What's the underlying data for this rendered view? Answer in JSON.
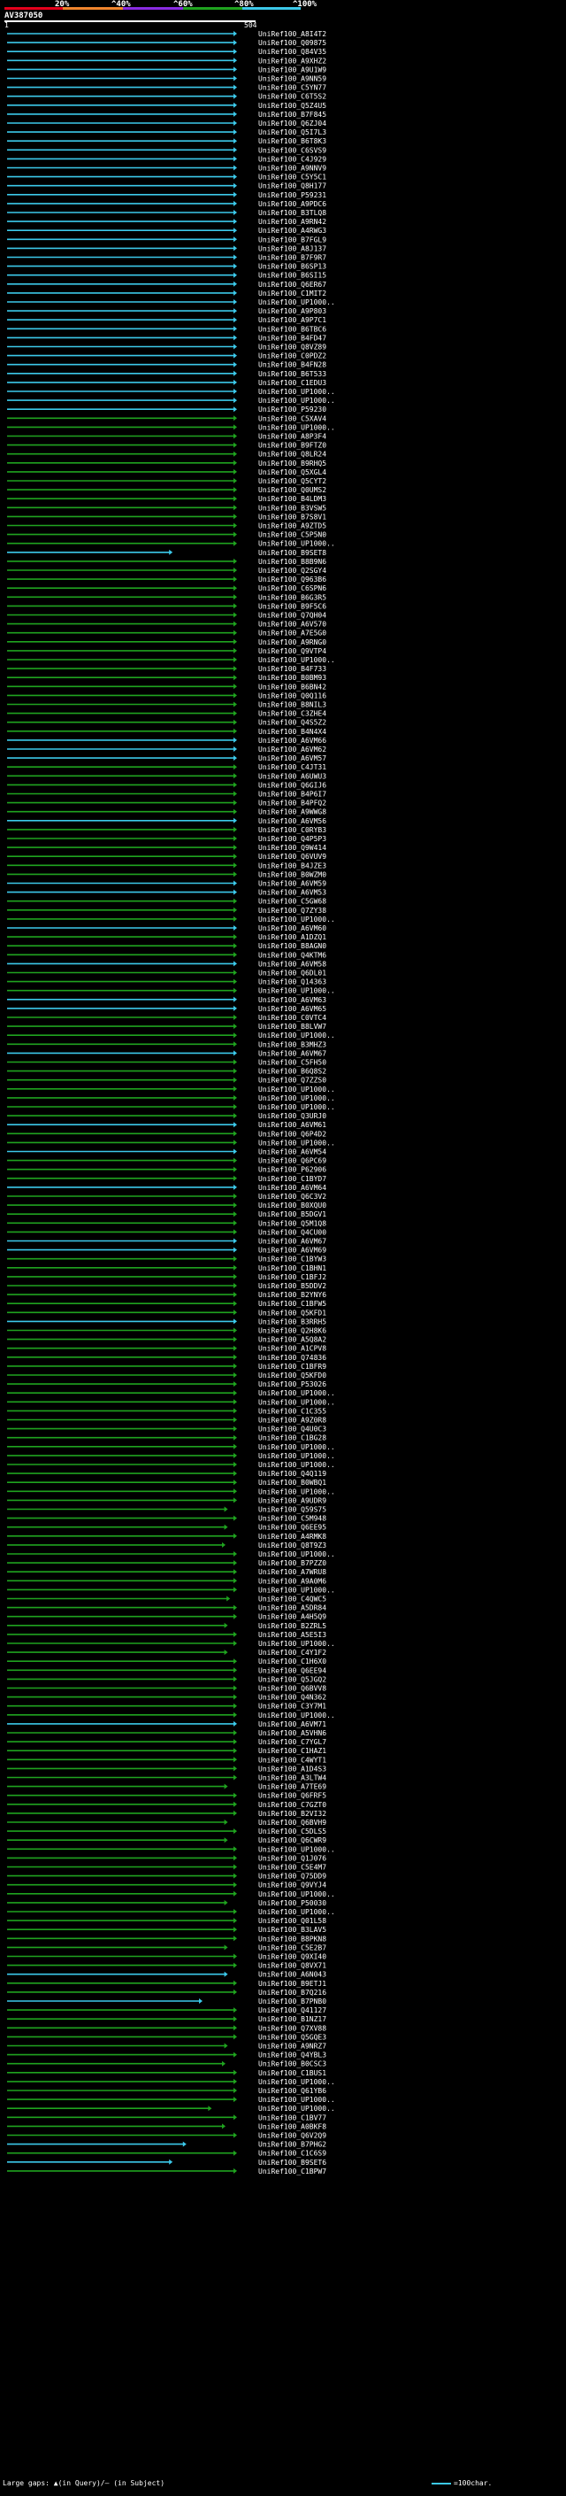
{
  "scale": {
    "ticks": [
      "20%",
      "^40%",
      "^60%",
      "^80%",
      "^100%"
    ],
    "colors": [
      "#e3001b",
      "#f0852d",
      "#8a2be2",
      "#1fa31f",
      "#3cc9ea"
    ]
  },
  "query": {
    "id": "AV387050",
    "start": "1",
    "end": "504"
  },
  "hits": [
    {
      "label": "UniRef100_A8I4T2",
      "end": 1,
      "c": "b"
    },
    {
      "label": "UniRef100_Q09875",
      "end": 1,
      "c": "b"
    },
    {
      "label": "UniRef100_Q84V35",
      "end": 1,
      "c": "b"
    },
    {
      "label": "UniRef100_A9XHZ2",
      "end": 1,
      "c": "b"
    },
    {
      "label": "UniRef100_A9U1W9",
      "end": 1,
      "c": "b"
    },
    {
      "label": "UniRef100_A9NN59",
      "end": 1,
      "c": "b"
    },
    {
      "label": "UniRef100_C5YN77",
      "end": 1,
      "c": "b"
    },
    {
      "label": "UniRef100_C6T5S2",
      "end": 1,
      "c": "b"
    },
    {
      "label": "UniRef100_Q5Z4U5",
      "end": 1,
      "c": "b"
    },
    {
      "label": "UniRef100_B7F845",
      "end": 1,
      "c": "b"
    },
    {
      "label": "UniRef100_Q6ZJ04",
      "end": 1,
      "c": "b"
    },
    {
      "label": "UniRef100_Q5I7L3",
      "end": 1,
      "c": "b"
    },
    {
      "label": "UniRef100_B6T8K3",
      "end": 1,
      "c": "b"
    },
    {
      "label": "UniRef100_C6SVS9",
      "end": 1,
      "c": "b"
    },
    {
      "label": "UniRef100_C4J929",
      "end": 1,
      "c": "b"
    },
    {
      "label": "UniRef100_A9NNV9",
      "end": 1,
      "c": "b"
    },
    {
      "label": "UniRef100_C5Y5C1",
      "end": 1,
      "c": "b"
    },
    {
      "label": "UniRef100_Q8H177",
      "end": 1,
      "c": "b"
    },
    {
      "label": "UniRef100_P59231",
      "end": 1,
      "c": "b"
    },
    {
      "label": "UniRef100_A9PDC6",
      "end": 1,
      "c": "b"
    },
    {
      "label": "UniRef100_B3TLQ8",
      "end": 1,
      "c": "b"
    },
    {
      "label": "UniRef100_A9RN42",
      "end": 1,
      "c": "b"
    },
    {
      "label": "UniRef100_A4RWG3",
      "end": 1,
      "c": "b"
    },
    {
      "label": "UniRef100_B7FGL9",
      "end": 1,
      "c": "b"
    },
    {
      "label": "UniRef100_A8J137",
      "end": 1,
      "c": "b"
    },
    {
      "label": "UniRef100_B7F9R7",
      "end": 1,
      "c": "b"
    },
    {
      "label": "UniRef100_B6SP13",
      "end": 1,
      "c": "b"
    },
    {
      "label": "UniRef100_B6SI15",
      "end": 1,
      "c": "b"
    },
    {
      "label": "UniRef100_Q6ER67",
      "end": 1,
      "c": "b"
    },
    {
      "label": "UniRef100_C1MIT2",
      "end": 1,
      "c": "b"
    },
    {
      "label": "UniRef100_UP1000..",
      "end": 1,
      "c": "b"
    },
    {
      "label": "UniRef100_A9P803",
      "end": 1,
      "c": "b"
    },
    {
      "label": "UniRef100_A9P7C1",
      "end": 1,
      "c": "b"
    },
    {
      "label": "UniRef100_B6TBC6",
      "end": 1,
      "c": "b"
    },
    {
      "label": "UniRef100_B4FD47",
      "end": 1,
      "c": "b"
    },
    {
      "label": "UniRef100_Q8VZ89",
      "end": 1,
      "c": "b"
    },
    {
      "label": "UniRef100_C0PDZ2",
      "end": 1,
      "c": "b"
    },
    {
      "label": "UniRef100_B4FN28",
      "end": 1,
      "c": "b"
    },
    {
      "label": "UniRef100_B6T533",
      "end": 1,
      "c": "b"
    },
    {
      "label": "UniRef100_C1EDU3",
      "end": 1,
      "c": "b"
    },
    {
      "label": "UniRef100_UP1000..",
      "end": 1,
      "c": "b"
    },
    {
      "label": "UniRef100_UP1000..",
      "end": 1,
      "c": "b"
    },
    {
      "label": "UniRef100_P59230",
      "end": 1,
      "c": "b"
    },
    {
      "label": "UniRef100_C5XAV4",
      "end": 1,
      "c": "g"
    },
    {
      "label": "UniRef100_UP1000..",
      "end": 1,
      "c": "g"
    },
    {
      "label": "UniRef100_A8P3F4",
      "end": 1,
      "c": "g"
    },
    {
      "label": "UniRef100_B9FTZ0",
      "end": 1,
      "c": "g"
    },
    {
      "label": "UniRef100_Q8LR24",
      "end": 1,
      "c": "g"
    },
    {
      "label": "UniRef100_B9RHQ5",
      "end": 1,
      "c": "g"
    },
    {
      "label": "UniRef100_Q5XGL4",
      "end": 1,
      "c": "g"
    },
    {
      "label": "UniRef100_Q5CYT2",
      "end": 1,
      "c": "g"
    },
    {
      "label": "UniRef100_Q0UMS2",
      "end": 1,
      "c": "g"
    },
    {
      "label": "UniRef100_B4LDM3",
      "end": 1,
      "c": "g"
    },
    {
      "label": "UniRef100_B3VSW5",
      "end": 1,
      "c": "g"
    },
    {
      "label": "UniRef100_B7S8V1",
      "end": 1,
      "c": "g"
    },
    {
      "label": "UniRef100_A9ZTD5",
      "end": 1,
      "c": "g"
    },
    {
      "label": "UniRef100_C5P5N0",
      "end": 1,
      "c": "g"
    },
    {
      "label": "UniRef100_UP1000..",
      "end": 1,
      "c": "g"
    },
    {
      "label": "UniRef100_B9SET8",
      "end": 0.72,
      "c": "b"
    },
    {
      "label": "UniRef100_B8B9N6",
      "end": 1,
      "c": "g"
    },
    {
      "label": "UniRef100_Q2SGY4",
      "end": 1,
      "c": "g"
    },
    {
      "label": "UniRef100_Q963B6",
      "end": 1,
      "c": "g"
    },
    {
      "label": "UniRef100_C6SPN6",
      "end": 1,
      "c": "g"
    },
    {
      "label": "UniRef100_B6G3R5",
      "end": 1,
      "c": "g"
    },
    {
      "label": "UniRef100_B9F5C6",
      "end": 1,
      "c": "g"
    },
    {
      "label": "UniRef100_Q7QH04",
      "end": 1,
      "c": "g"
    },
    {
      "label": "UniRef100_A6V570",
      "end": 1,
      "c": "g"
    },
    {
      "label": "UniRef100_A7E5G0",
      "end": 1,
      "c": "g"
    },
    {
      "label": "UniRef100_A9RNG0",
      "end": 1,
      "c": "g"
    },
    {
      "label": "UniRef100_Q9VTP4",
      "end": 1,
      "c": "g"
    },
    {
      "label": "UniRef100_UP1000..",
      "end": 1,
      "c": "g"
    },
    {
      "label": "UniRef100_B4F733",
      "end": 1,
      "c": "g"
    },
    {
      "label": "UniRef100_B0BM93",
      "end": 1,
      "c": "g"
    },
    {
      "label": "UniRef100_B6BN42",
      "end": 1,
      "c": "g"
    },
    {
      "label": "UniRef100_Q0Q116",
      "end": 1,
      "c": "g"
    },
    {
      "label": "UniRef100_B8NIL3",
      "end": 1,
      "c": "g"
    },
    {
      "label": "UniRef100_C3ZHE4",
      "end": 1,
      "c": "g"
    },
    {
      "label": "UniRef100_Q4S5Z2",
      "end": 1,
      "c": "g"
    },
    {
      "label": "UniRef100_B4N4X4",
      "end": 1,
      "c": "g"
    },
    {
      "label": "UniRef100_A6VM66",
      "end": 1,
      "c": "b"
    },
    {
      "label": "UniRef100_A6VM62",
      "end": 1,
      "c": "b"
    },
    {
      "label": "UniRef100_A6VM57",
      "end": 1,
      "c": "b"
    },
    {
      "label": "UniRef100_C4JT31",
      "end": 1,
      "c": "g"
    },
    {
      "label": "UniRef100_A6UWU3",
      "end": 1,
      "c": "g"
    },
    {
      "label": "UniRef100_Q6GIJ6",
      "end": 1,
      "c": "g"
    },
    {
      "label": "UniRef100_B4P6I7",
      "end": 1,
      "c": "g"
    },
    {
      "label": "UniRef100_B4PFQ2",
      "end": 1,
      "c": "g"
    },
    {
      "label": "UniRef100_A9WWG8",
      "end": 1,
      "c": "g"
    },
    {
      "label": "UniRef100_A6VM56",
      "end": 1,
      "c": "b"
    },
    {
      "label": "UniRef100_C0RYB3",
      "end": 1,
      "c": "g"
    },
    {
      "label": "UniRef100_Q4P5P3",
      "end": 1,
      "c": "g"
    },
    {
      "label": "UniRef100_Q9W414",
      "end": 1,
      "c": "g"
    },
    {
      "label": "UniRef100_Q6VUV9",
      "end": 1,
      "c": "g"
    },
    {
      "label": "UniRef100_B4JZE3",
      "end": 1,
      "c": "g"
    },
    {
      "label": "UniRef100_B0WZM0",
      "end": 1,
      "c": "g"
    },
    {
      "label": "UniRef100_A6VM59",
      "end": 1,
      "c": "b"
    },
    {
      "label": "UniRef100_A6VM53",
      "end": 1,
      "c": "b"
    },
    {
      "label": "UniRef100_C5GW68",
      "end": 1,
      "c": "g"
    },
    {
      "label": "UniRef100_Q7ZY38",
      "end": 1,
      "c": "g"
    },
    {
      "label": "UniRef100_UP1000..",
      "end": 1,
      "c": "g"
    },
    {
      "label": "UniRef100_A6VM60",
      "end": 1,
      "c": "b"
    },
    {
      "label": "UniRef100_A1DZQ1",
      "end": 1,
      "c": "g"
    },
    {
      "label": "UniRef100_B8AGN0",
      "end": 1,
      "c": "g"
    },
    {
      "label": "UniRef100_Q4KTM6",
      "end": 1,
      "c": "g"
    },
    {
      "label": "UniRef100_A6VM58",
      "end": 1,
      "c": "b"
    },
    {
      "label": "UniRef100_Q6DL01",
      "end": 1,
      "c": "g"
    },
    {
      "label": "UniRef100_Q14363",
      "end": 1,
      "c": "g"
    },
    {
      "label": "UniRef100_UP1000..",
      "end": 1,
      "c": "g"
    },
    {
      "label": "UniRef100_A6VM63",
      "end": 1,
      "c": "b"
    },
    {
      "label": "UniRef100_A6VM65",
      "end": 1,
      "c": "b"
    },
    {
      "label": "UniRef100_C0VTC4",
      "end": 1,
      "c": "g"
    },
    {
      "label": "UniRef100_B8LVW7",
      "end": 1,
      "c": "g"
    },
    {
      "label": "UniRef100_UP1000..",
      "end": 1,
      "c": "g"
    },
    {
      "label": "UniRef100_B3MHZ3",
      "end": 1,
      "c": "g"
    },
    {
      "label": "UniRef100_A6VM67",
      "end": 1,
      "c": "b"
    },
    {
      "label": "UniRef100_C5FH50",
      "end": 1,
      "c": "g"
    },
    {
      "label": "UniRef100_B6Q8S2",
      "end": 1,
      "c": "g"
    },
    {
      "label": "UniRef100_Q7ZZS0",
      "end": 1,
      "c": "g"
    },
    {
      "label": "UniRef100_UP1000..",
      "end": 1,
      "c": "g"
    },
    {
      "label": "UniRef100_UP1000..",
      "end": 1,
      "c": "g"
    },
    {
      "label": "UniRef100_UP1000..",
      "end": 1,
      "c": "g"
    },
    {
      "label": "UniRef100_Q3URJ0",
      "end": 1,
      "c": "g"
    },
    {
      "label": "UniRef100_A6VM61",
      "end": 1,
      "c": "b"
    },
    {
      "label": "UniRef100_Q6P4D2",
      "end": 1,
      "c": "g"
    },
    {
      "label": "UniRef100_UP1000..",
      "end": 1,
      "c": "g"
    },
    {
      "label": "UniRef100_A6VM54",
      "end": 1,
      "c": "b"
    },
    {
      "label": "UniRef100_Q6PC69",
      "end": 1,
      "c": "g"
    },
    {
      "label": "UniRef100_P62906",
      "end": 1,
      "c": "g"
    },
    {
      "label": "UniRef100_C1BYD7",
      "end": 1,
      "c": "g"
    },
    {
      "label": "UniRef100_A6VM64",
      "end": 1,
      "c": "b"
    },
    {
      "label": "UniRef100_Q6C3V2",
      "end": 1,
      "c": "g"
    },
    {
      "label": "UniRef100_B0XQU0",
      "end": 1,
      "c": "g"
    },
    {
      "label": "UniRef100_B5DGV1",
      "end": 1,
      "c": "g"
    },
    {
      "label": "UniRef100_Q5M1Q8",
      "end": 1,
      "c": "g"
    },
    {
      "label": "UniRef100_Q4CU00",
      "end": 1,
      "c": "g"
    },
    {
      "label": "UniRef100_A6VM67",
      "end": 1,
      "c": "b"
    },
    {
      "label": "UniRef100_A6VM69",
      "end": 1,
      "c": "b"
    },
    {
      "label": "UniRef100_C1BYW3",
      "end": 1,
      "c": "g"
    },
    {
      "label": "UniRef100_C1BHN1",
      "end": 1,
      "c": "g"
    },
    {
      "label": "UniRef100_C1BFJ2",
      "end": 1,
      "c": "g"
    },
    {
      "label": "UniRef100_B5DDV2",
      "end": 1,
      "c": "g"
    },
    {
      "label": "UniRef100_B2YNY6",
      "end": 1,
      "c": "g"
    },
    {
      "label": "UniRef100_C1BFW5",
      "end": 1,
      "c": "g"
    },
    {
      "label": "UniRef100_Q5KFD1",
      "end": 1,
      "c": "g"
    },
    {
      "label": "UniRef100_B3RRH5",
      "end": 1,
      "c": "b"
    },
    {
      "label": "UniRef100_Q2H8K6",
      "end": 1,
      "c": "g"
    },
    {
      "label": "UniRef100_A5Q8A2",
      "end": 1,
      "c": "g"
    },
    {
      "label": "UniRef100_A1CPV8",
      "end": 1,
      "c": "g"
    },
    {
      "label": "UniRef100_Q74836",
      "end": 1,
      "c": "g"
    },
    {
      "label": "UniRef100_C1BFR9",
      "end": 1,
      "c": "g"
    },
    {
      "label": "UniRef100_Q5KFD0",
      "end": 1,
      "c": "g"
    },
    {
      "label": "UniRef100_P53026",
      "end": 1,
      "c": "g"
    },
    {
      "label": "UniRef100_UP1000..",
      "end": 1,
      "c": "g"
    },
    {
      "label": "UniRef100_UP1000..",
      "end": 1,
      "c": "g"
    },
    {
      "label": "UniRef100_C1C355",
      "end": 1,
      "c": "g"
    },
    {
      "label": "UniRef100_A9Z0R8",
      "end": 1,
      "c": "g"
    },
    {
      "label": "UniRef100_Q4U0C3",
      "end": 1,
      "c": "g"
    },
    {
      "label": "UniRef100_C1BG28",
      "end": 1,
      "c": "g"
    },
    {
      "label": "UniRef100_UP1000..",
      "end": 1,
      "c": "g"
    },
    {
      "label": "UniRef100_UP1000..",
      "end": 1,
      "c": "g"
    },
    {
      "label": "UniRef100_UP1000..",
      "end": 1,
      "c": "g"
    },
    {
      "label": "UniRef100_Q4Q119",
      "end": 1,
      "c": "g"
    },
    {
      "label": "UniRef100_B0WBQ1",
      "end": 1,
      "c": "g"
    },
    {
      "label": "UniRef100_UP1000..",
      "end": 1,
      "c": "g"
    },
    {
      "label": "UniRef100_A9UDR9",
      "end": 1,
      "c": "g"
    },
    {
      "label": "UniRef100_Q59S75",
      "end": 0.96,
      "c": "g"
    },
    {
      "label": "UniRef100_C5M948",
      "end": 1,
      "c": "g"
    },
    {
      "label": "UniRef100_Q6EE95",
      "end": 0.96,
      "c": "g"
    },
    {
      "label": "UniRef100_A4RMK8",
      "end": 1,
      "c": "g"
    },
    {
      "label": "UniRef100_Q8T9Z3",
      "end": 0.95,
      "c": "g"
    },
    {
      "label": "UniRef100_UP1000..",
      "end": 1,
      "c": "g"
    },
    {
      "label": "UniRef100_B7PZZ0",
      "end": 1,
      "c": "g"
    },
    {
      "label": "UniRef100_A7WRU8",
      "end": 1,
      "c": "g"
    },
    {
      "label": "UniRef100_A9A0M6",
      "end": 1,
      "c": "g"
    },
    {
      "label": "UniRef100_UP1000..",
      "end": 1,
      "c": "g"
    },
    {
      "label": "UniRef100_C4QWC5",
      "end": 0.97,
      "c": "g"
    },
    {
      "label": "UniRef100_A5DR84",
      "end": 1,
      "c": "g"
    },
    {
      "label": "UniRef100_A4H5Q9",
      "end": 1,
      "c": "g"
    },
    {
      "label": "UniRef100_B2ZRL5",
      "end": 0.96,
      "c": "g"
    },
    {
      "label": "UniRef100_A5E5I3",
      "end": 1,
      "c": "g"
    },
    {
      "label": "UniRef100_UP1000..",
      "end": 1,
      "c": "g"
    },
    {
      "label": "UniRef100_C4Y1F2",
      "end": 0.96,
      "c": "g"
    },
    {
      "label": "UniRef100_C1H6X0",
      "end": 1,
      "c": "g"
    },
    {
      "label": "UniRef100_Q6EE94",
      "end": 1,
      "c": "g"
    },
    {
      "label": "UniRef100_Q5JGQ2",
      "end": 1,
      "c": "g"
    },
    {
      "label": "UniRef100_Q6BVV8",
      "end": 1,
      "c": "g"
    },
    {
      "label": "UniRef100_Q4N362",
      "end": 1,
      "c": "g"
    },
    {
      "label": "UniRef100_C3Y7M1",
      "end": 1,
      "c": "g"
    },
    {
      "label": "UniRef100_UP1000..",
      "end": 1,
      "c": "g"
    },
    {
      "label": "UniRef100_A6VM71",
      "end": 1,
      "c": "b"
    },
    {
      "label": "UniRef100_A5VHN6",
      "end": 1,
      "c": "g"
    },
    {
      "label": "UniRef100_C7YGL7",
      "end": 1,
      "c": "g"
    },
    {
      "label": "UniRef100_C1HAZ1",
      "end": 1,
      "c": "g"
    },
    {
      "label": "UniRef100_C4WYT1",
      "end": 1,
      "c": "g"
    },
    {
      "label": "UniRef100_A1D4S3",
      "end": 1,
      "c": "g"
    },
    {
      "label": "UniRef100_A3LTW4",
      "end": 1,
      "c": "g"
    },
    {
      "label": "UniRef100_A7TE69",
      "end": 0.96,
      "c": "g"
    },
    {
      "label": "UniRef100_Q6FRF5",
      "end": 1,
      "c": "g"
    },
    {
      "label": "UniRef100_C7GZT0",
      "end": 1,
      "c": "g"
    },
    {
      "label": "UniRef100_B2VI32",
      "end": 1,
      "c": "g"
    },
    {
      "label": "UniRef100_Q6BVH9",
      "end": 0.96,
      "c": "g"
    },
    {
      "label": "UniRef100_C5DLS5",
      "end": 1,
      "c": "g"
    },
    {
      "label": "UniRef100_Q6CWR9",
      "end": 0.96,
      "c": "g"
    },
    {
      "label": "UniRef100_UP1000..",
      "end": 1,
      "c": "g"
    },
    {
      "label": "UniRef100_Q1J076",
      "end": 1,
      "c": "g"
    },
    {
      "label": "UniRef100_C5E4M7",
      "end": 1,
      "c": "g"
    },
    {
      "label": "UniRef100_Q75DD9",
      "end": 1,
      "c": "g"
    },
    {
      "label": "UniRef100_Q9VYJ4",
      "end": 1,
      "c": "g"
    },
    {
      "label": "UniRef100_UP1000..",
      "end": 1,
      "c": "g"
    },
    {
      "label": "UniRef100_P50030",
      "end": 0.96,
      "c": "g"
    },
    {
      "label": "UniRef100_UP1000..",
      "end": 1,
      "c": "g"
    },
    {
      "label": "UniRef100_Q01L58",
      "end": 1,
      "c": "g"
    },
    {
      "label": "UniRef100_B3LAV5",
      "end": 1,
      "c": "g"
    },
    {
      "label": "UniRef100_B8PKN8",
      "end": 1,
      "c": "g"
    },
    {
      "label": "UniRef100_C5E2B7",
      "end": 0.96,
      "c": "g"
    },
    {
      "label": "UniRef100_Q9XI40",
      "end": 1,
      "c": "g"
    },
    {
      "label": "UniRef100_Q8VX71",
      "end": 1,
      "c": "g"
    },
    {
      "label": "UniRef100_A6N043",
      "end": 0.96,
      "c": "b"
    },
    {
      "label": "UniRef100_B9ETJ1",
      "end": 1,
      "c": "g"
    },
    {
      "label": "UniRef100_B7Q216",
      "end": 1,
      "c": "g"
    },
    {
      "label": "UniRef100_B7PNB0",
      "end": 0.85,
      "c": "b"
    },
    {
      "label": "UniRef100_Q41127",
      "end": 1,
      "c": "g"
    },
    {
      "label": "UniRef100_B1NZ17",
      "end": 1,
      "c": "g"
    },
    {
      "label": "UniRef100_Q7XV88",
      "end": 1,
      "c": "g"
    },
    {
      "label": "UniRef100_Q5GQE3",
      "end": 1,
      "c": "g"
    },
    {
      "label": "UniRef100_A9NRZ7",
      "end": 0.96,
      "c": "g"
    },
    {
      "label": "UniRef100_Q4YBL3",
      "end": 1,
      "c": "g"
    },
    {
      "label": "UniRef100_B0CSC3",
      "end": 0.95,
      "c": "g"
    },
    {
      "label": "UniRef100_C1BUS1",
      "end": 1,
      "c": "g"
    },
    {
      "label": "UniRef100_UP1000..",
      "end": 1,
      "c": "g"
    },
    {
      "label": "UniRef100_Q61YB6",
      "end": 1,
      "c": "g"
    },
    {
      "label": "UniRef100_UP1000..",
      "end": 1,
      "c": "g"
    },
    {
      "label": "UniRef100_UP1000..",
      "end": 0.89,
      "c": "g"
    },
    {
      "label": "UniRef100_C1BV77",
      "end": 1,
      "c": "g"
    },
    {
      "label": "UniRef100_A0BKF8",
      "end": 0.95,
      "c": "g"
    },
    {
      "label": "UniRef100_Q6V2Q9",
      "end": 1,
      "c": "g"
    },
    {
      "label": "UniRef100_B7PHG2",
      "end": 0.78,
      "c": "b"
    },
    {
      "label": "UniRef100_C1C6S9",
      "end": 1,
      "c": "g"
    },
    {
      "label": "UniRef100_B9SET6",
      "end": 0.72,
      "c": "b"
    },
    {
      "label": "UniRef100_C1BPW7",
      "end": 1,
      "c": "g"
    }
  ],
  "footer": {
    "left": "Large gaps: ▲(in Query)/– (in Subject)",
    "right": "=100char."
  }
}
